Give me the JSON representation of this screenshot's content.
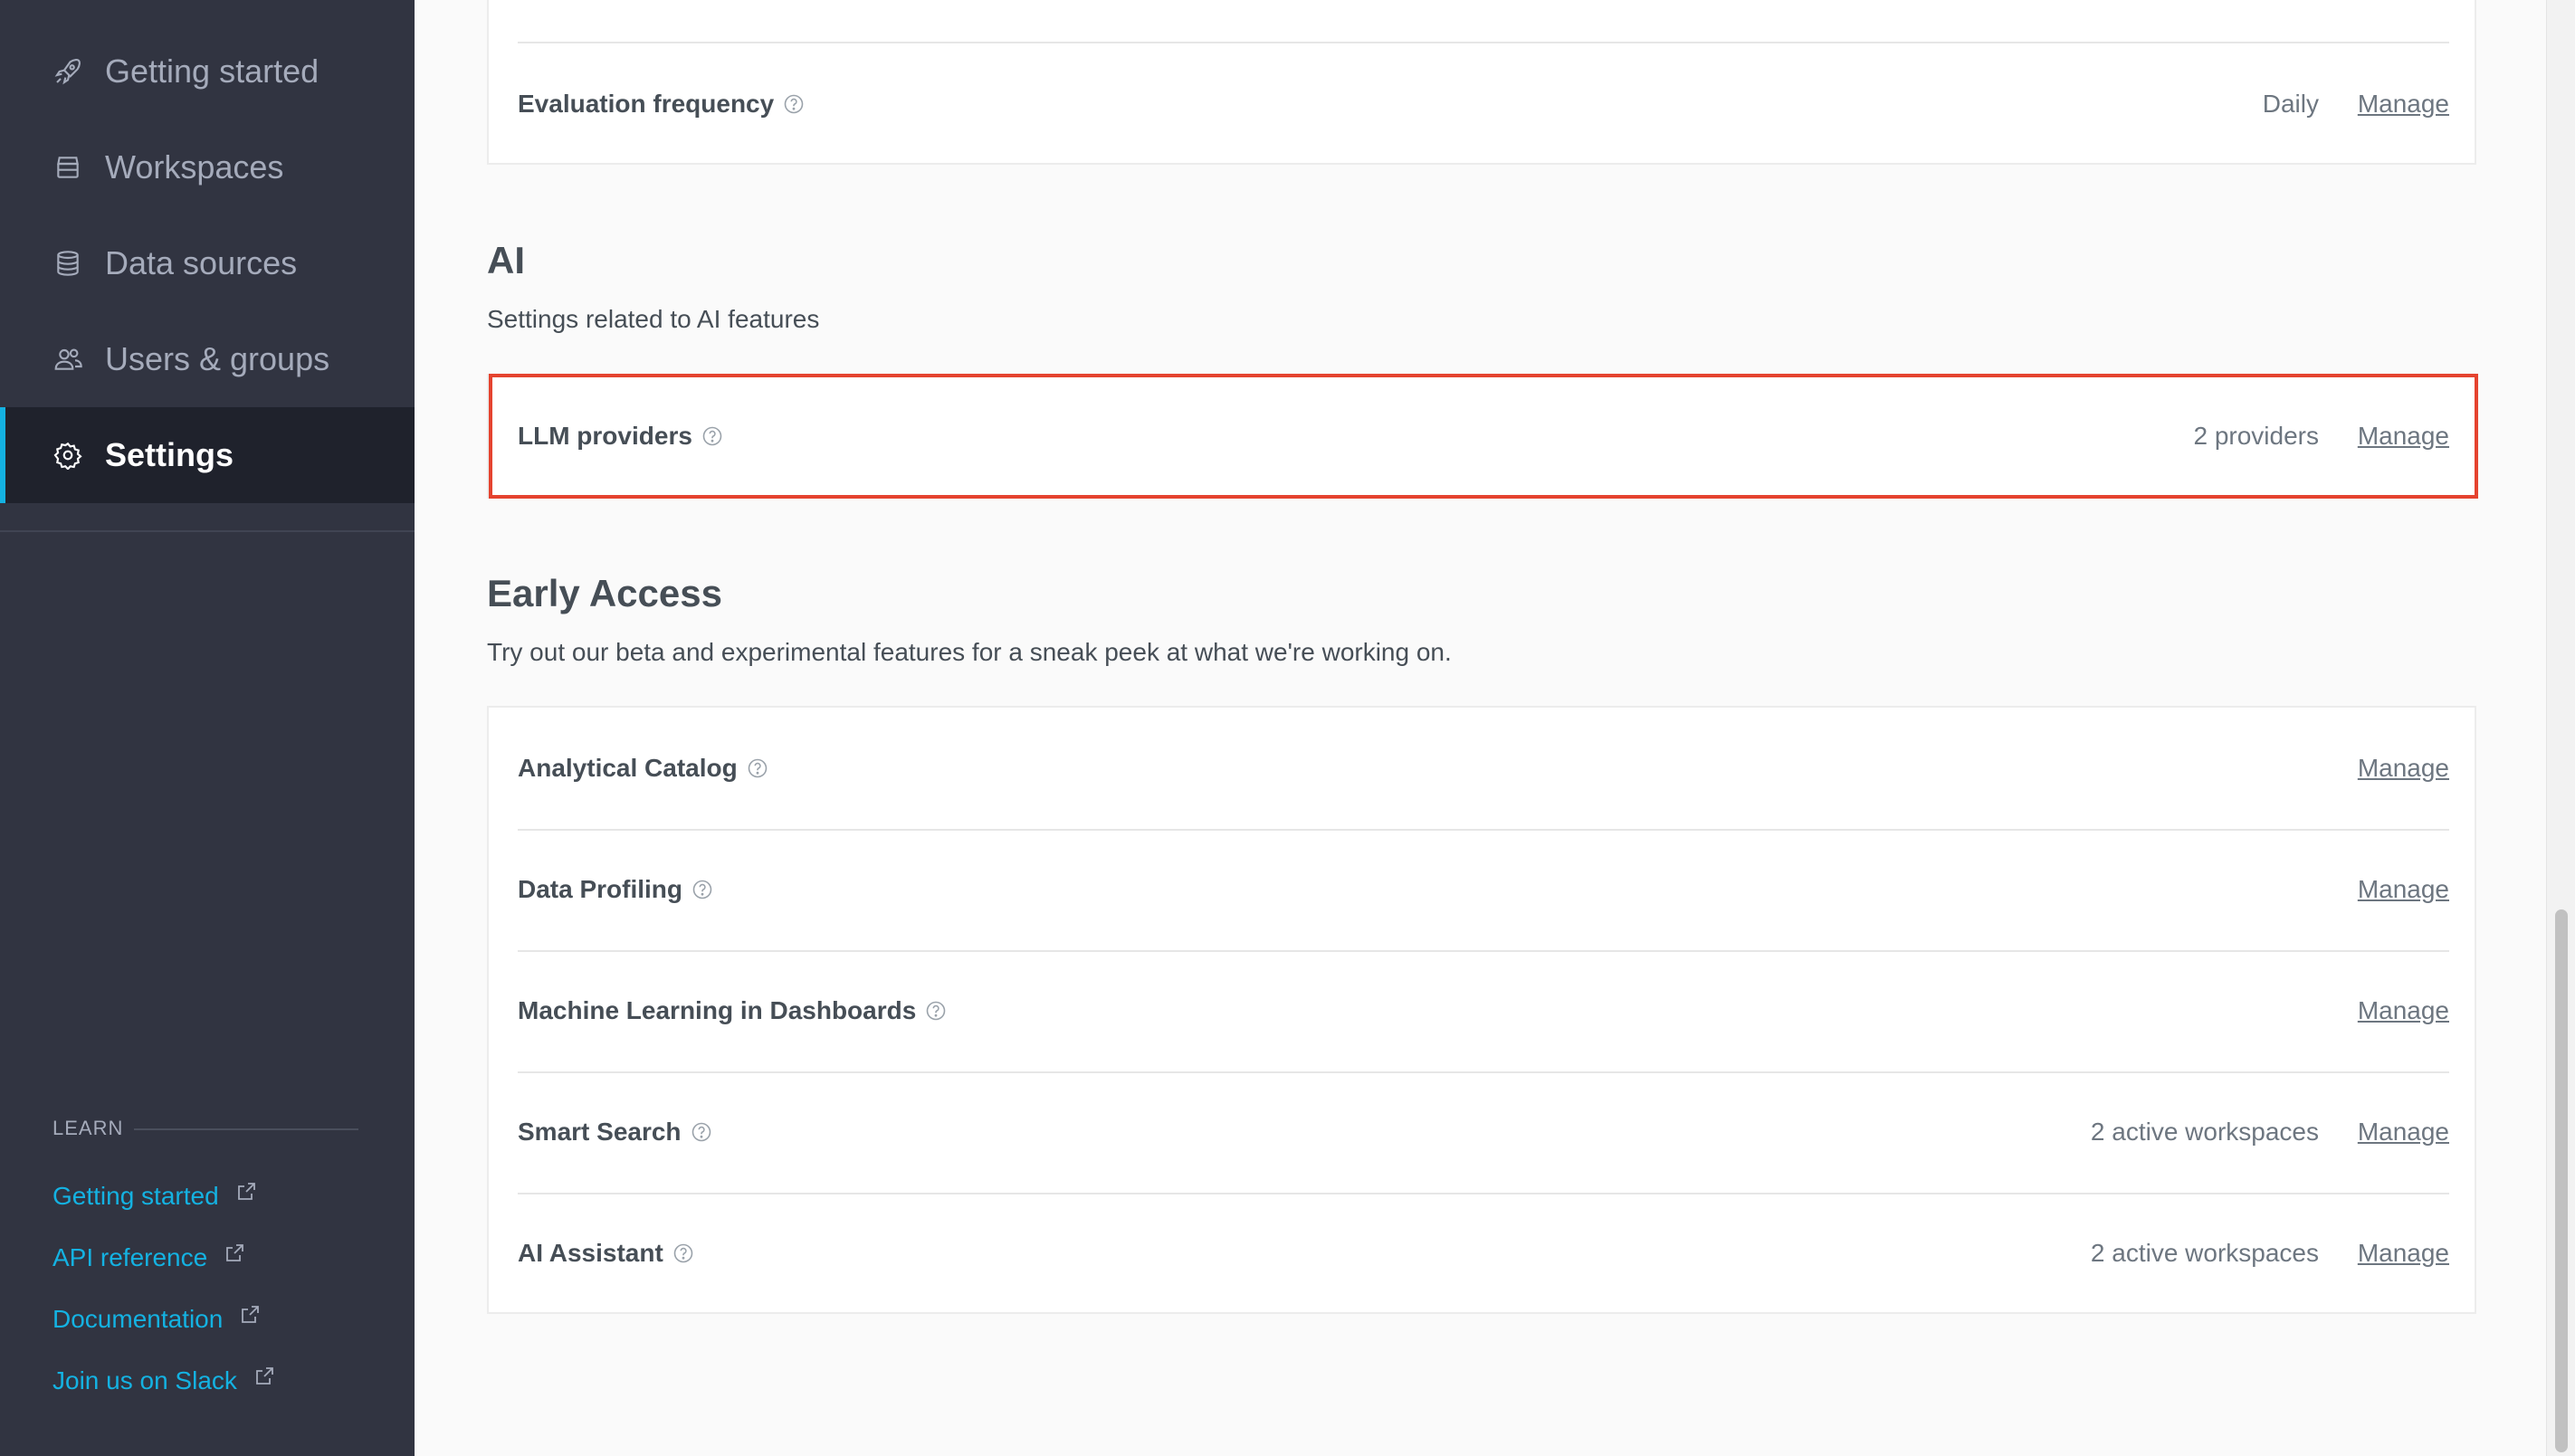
{
  "sidebar": {
    "nav": [
      {
        "label": "Getting started",
        "icon": "rocket-icon"
      },
      {
        "label": "Workspaces",
        "icon": "workspace-icon"
      },
      {
        "label": "Data sources",
        "icon": "database-icon"
      },
      {
        "label": "Users & groups",
        "icon": "users-icon"
      },
      {
        "label": "Settings",
        "icon": "gear-icon",
        "active": true
      }
    ],
    "learn": {
      "title": "LEARN",
      "links": [
        {
          "label": "Getting started"
        },
        {
          "label": "API reference"
        },
        {
          "label": "Documentation"
        },
        {
          "label": "Join us on Slack"
        }
      ]
    }
  },
  "top_card": {
    "rows": [
      {
        "title": "Evaluation frequency",
        "value": "Daily",
        "manage": "Manage"
      }
    ]
  },
  "ai_section": {
    "title": "AI",
    "description": "Settings related to AI features",
    "rows": [
      {
        "title": "LLM providers",
        "value": "2 providers",
        "manage": "Manage"
      }
    ]
  },
  "early_access": {
    "title": "Early Access",
    "description": "Try out our beta and experimental features for a sneak peek at what we're working on.",
    "rows": [
      {
        "title": "Analytical Catalog",
        "value": "",
        "manage": "Manage"
      },
      {
        "title": "Data Profiling",
        "value": "",
        "manage": "Manage"
      },
      {
        "title": "Machine Learning in Dashboards",
        "value": "",
        "manage": "Manage"
      },
      {
        "title": "Smart Search",
        "value": "2 active workspaces",
        "manage": "Manage"
      },
      {
        "title": "AI Assistant",
        "value": "2 active workspaces",
        "manage": "Manage"
      }
    ]
  },
  "colors": {
    "sidebar_bg": "#313441",
    "sidebar_active_bg": "#1f222c",
    "accent": "#14b2e2",
    "highlight": "#e5432f"
  }
}
